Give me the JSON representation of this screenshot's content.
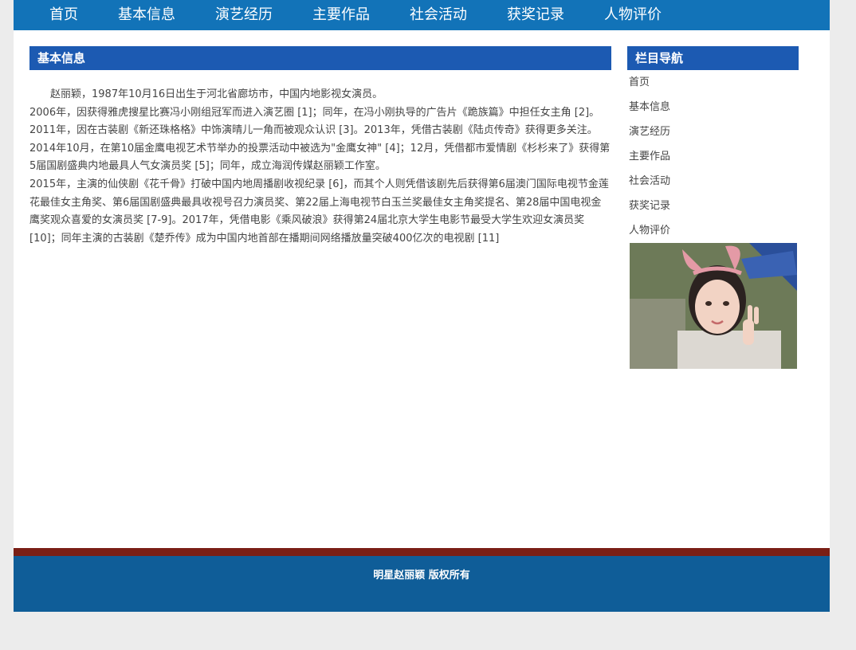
{
  "nav": {
    "items": [
      "首页",
      "基本信息",
      "演艺经历",
      "主要作品",
      "社会活动",
      "获奖记录",
      "人物评价"
    ]
  },
  "main": {
    "heading": "基本信息",
    "paragraphs": [
      "赵丽颖，1987年10月16日出生于河北省廊坊市，中国内地影视女演员。",
      "2006年，因获得雅虎搜星比赛冯小刚组冠军而进入演艺圈 [1]；同年，在冯小刚执导的广告片《跪族篇》中担任女主角 [2]。2011年，因在古装剧《新还珠格格》中饰演晴儿一角而被观众认识 [3]。2013年，凭借古装剧《陆贞传奇》获得更多关注。2014年10月，在第10届金鹰电视艺术节举办的投票活动中被选为\"金鹰女神\" [4]；12月，凭借都市爱情剧《杉杉来了》获得第5届国剧盛典内地最具人气女演员奖 [5]；同年，成立海润传媒赵丽颖工作室。",
      "2015年，主演的仙侠剧《花千骨》打破中国内地周播剧收视纪录 [6]，而其个人则凭借该剧先后获得第6届澳门国际电视节金莲花最佳女主角奖、第6届国剧盛典最具收视号召力演员奖、第22届上海电视节白玉兰奖最佳女主角奖提名、第28届中国电视金鹰奖观众喜爱的女演员奖 [7-9]。2017年，凭借电影《乘风破浪》获得第24届北京大学生电影节最受大学生欢迎女演员奖 [10]；同年主演的古装剧《楚乔传》成为中国内地首部在播期间网络播放量突破400亿次的电视剧 [11]"
    ]
  },
  "sidebar": {
    "heading": "栏目导航",
    "items": [
      "首页",
      "基本信息",
      "演艺经历",
      "主要作品",
      "社会活动",
      "获奖记录",
      "人物评价"
    ]
  },
  "footer": {
    "text": "明星赵丽颖 版权所有"
  },
  "colors": {
    "nav_bg": "#1273b8",
    "heading_bar": "#1c5ab2",
    "footer_line": "#7a1f16",
    "footer_bg": "#0f5d98",
    "page_bg": "#ececec"
  }
}
